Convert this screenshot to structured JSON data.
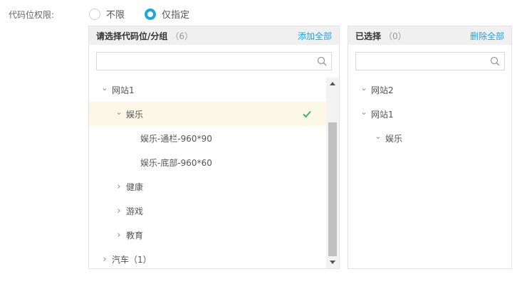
{
  "permission": {
    "label": "代码位权限:",
    "options": [
      {
        "label": "不限",
        "checked": false
      },
      {
        "label": "仅指定",
        "checked": true
      }
    ]
  },
  "left_panel": {
    "title": "请选择代码位/分组",
    "count": "（6）",
    "action": "添加全部",
    "search_placeholder": "",
    "tree": [
      {
        "label": "网站1",
        "chevron": "down",
        "level": 0
      },
      {
        "label": "娱乐",
        "chevron": "down",
        "level": 1,
        "selected": true,
        "checked": true
      },
      {
        "label": "娱乐-通栏-960*90",
        "chevron": "",
        "level": 2
      },
      {
        "label": "娱乐-底部-960*60",
        "chevron": "",
        "level": 2
      },
      {
        "label": "健康",
        "chevron": "right",
        "level": 1
      },
      {
        "label": "游戏",
        "chevron": "right",
        "level": 1
      },
      {
        "label": "教育",
        "chevron": "right",
        "level": 1
      },
      {
        "label": "汽车（1）",
        "chevron": "right",
        "level": 0
      }
    ]
  },
  "right_panel": {
    "title": "已选择",
    "count": "（0）",
    "action": "删除全部",
    "search_placeholder": "",
    "tree": [
      {
        "label": "网站2",
        "chevron": "down",
        "level": 0
      },
      {
        "label": "网站1",
        "chevron": "down",
        "level": 0
      },
      {
        "label": "娱乐",
        "chevron": "down",
        "level": 1
      }
    ]
  },
  "colors": {
    "accent": "#1aa6e0",
    "check": "#3cb371",
    "selected_row": "#fdf7e8",
    "header_bg": "#f0f0f0"
  },
  "icons": {
    "search": "search-icon",
    "check": "check-icon",
    "chevron_down": "chevron-down-icon",
    "chevron_right": "chevron-right-icon"
  }
}
